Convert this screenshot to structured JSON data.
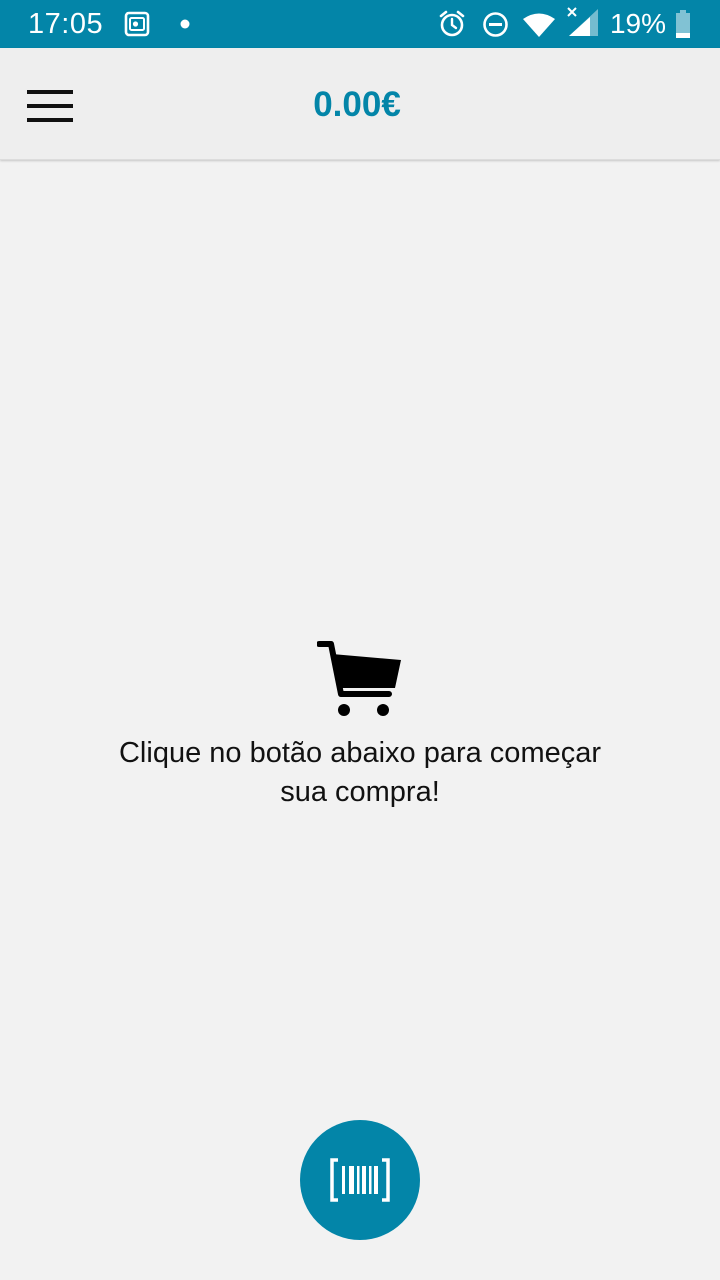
{
  "status_bar": {
    "time": "17:05",
    "battery_percent": "19%",
    "battery_level": 0.19,
    "icons": [
      "screenshot-icon",
      "notification-dot-icon",
      "alarm-icon",
      "do-not-disturb-icon",
      "wifi-icon",
      "cellular-no-data-icon",
      "battery-icon"
    ],
    "background_color": "#0385a8"
  },
  "app_bar": {
    "menu_icon": "hamburger-menu-icon",
    "total": "0.00€",
    "accent_color": "#0385a8"
  },
  "empty_cart": {
    "icon": "shopping-cart-icon",
    "message": "Clique no botão abaixo para começar sua compra!"
  },
  "scan_button": {
    "icon": "barcode-scan-icon",
    "color": "#0385a8"
  }
}
